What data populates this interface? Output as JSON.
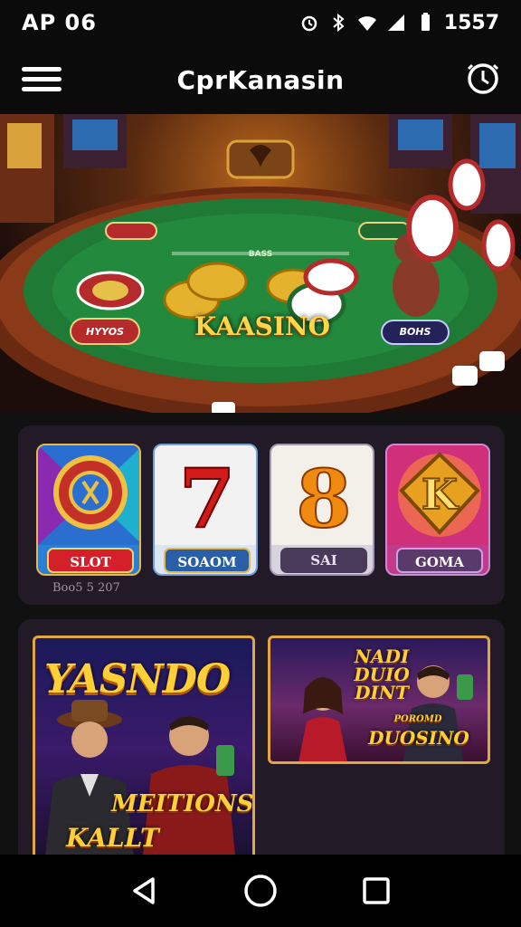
{
  "status_bar": {
    "carrier": "AP 06",
    "time": "1557",
    "icons": [
      "alarm-icon",
      "bluetooth-icon",
      "wifi-icon",
      "signal-icon",
      "battery-icon"
    ]
  },
  "app_bar": {
    "title": "CprKanasin",
    "menu_icon": "hamburger-menu-icon",
    "action_icon": "alarm-clock-icon"
  },
  "hero": {
    "title": "KAASINO",
    "chip_left": "HYYOS",
    "chip_right": "BOHS",
    "rail_text": "BASS"
  },
  "games": {
    "tiles": [
      {
        "label": "SLOT",
        "art": "roulette-wheel-icon"
      },
      {
        "label": "SOAOM",
        "art": "seven",
        "art_text": "7"
      },
      {
        "label": "SAI",
        "art": "eight",
        "art_text": "8"
      },
      {
        "label": "GOMA",
        "art": "k-badge",
        "art_text": "K"
      }
    ],
    "footer": "Boo5 5 207"
  },
  "promos": {
    "big": {
      "title": "YASNDO",
      "line1": "MEITIONS",
      "line2": "KALLT SBINS"
    },
    "small": {
      "line1": "NADI",
      "line2": "DUIO",
      "line3": "DINT",
      "line4": "DUOSINO",
      "line0": "POROMD"
    }
  },
  "colors": {
    "background": "#111111",
    "panel": "#231a28",
    "felt": "#1f7a36",
    "gold": "#ffcf3a",
    "tile_label_red": "#d3202a",
    "tile_label_blue": "#2a6fb8",
    "tile_label_purple": "#5a3a6a"
  },
  "nav": {
    "back_icon": "back-triangle-icon",
    "home_icon": "home-circle-icon",
    "recents_icon": "recents-square-icon"
  }
}
